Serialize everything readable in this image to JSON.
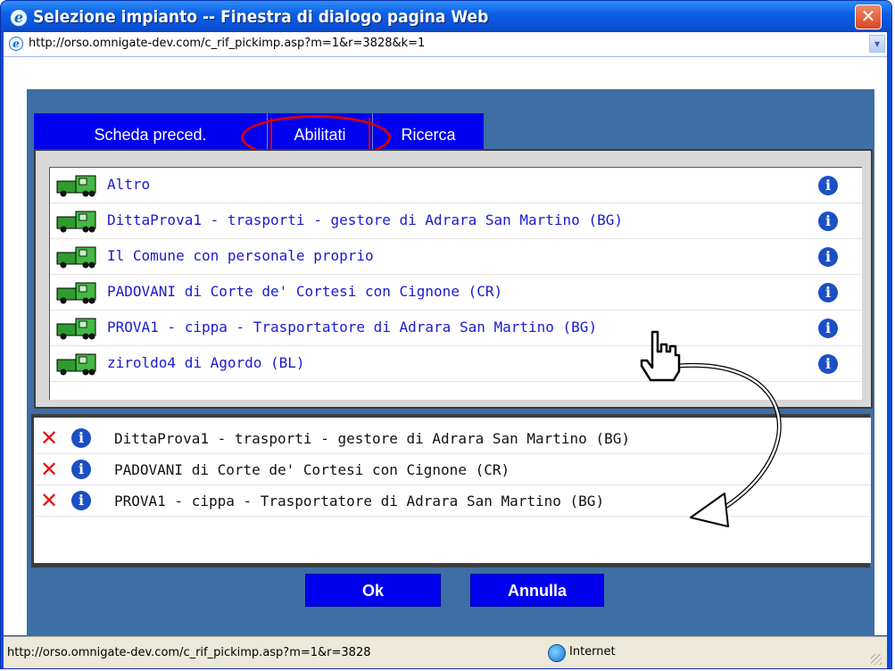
{
  "window": {
    "title": "Selezione impianto -- Finestra di dialogo pagina Web",
    "close_icon": "close-icon"
  },
  "address": {
    "url": "http://orso.omnigate-dev.com/c_rif_pickimp.asp?m=1&r=3828&k=1"
  },
  "tabs": [
    {
      "label": "Scheda preced."
    },
    {
      "label": "Abilitati"
    },
    {
      "label": "Ricerca"
    }
  ],
  "available_items": [
    {
      "label": "Altro"
    },
    {
      "label": "DittaProva1 - trasporti - gestore di Adrara San Martino (BG)"
    },
    {
      "label": "Il Comune con personale proprio"
    },
    {
      "label": "PADOVANI di Corte de' Cortesi con Cignone (CR)"
    },
    {
      "label": "PROVA1 - cippa - Trasportatore di Adrara San Martino (BG)"
    },
    {
      "label": "ziroldo4 di Agordo (BL)"
    }
  ],
  "selected_items": [
    {
      "label": "DittaProva1 - trasporti - gestore di Adrara San Martino (BG)"
    },
    {
      "label": "PADOVANI di Corte de' Cortesi con Cignone (CR)"
    },
    {
      "label": "PROVA1 - cippa - Trasportatore di Adrara San Martino (BG)"
    }
  ],
  "buttons": {
    "ok": "Ok",
    "cancel": "Annulla"
  },
  "status": {
    "url": "http://orso.omnigate-dev.com/c_rif_pickimp.asp?m=1&r=3828",
    "zone": "Internet"
  },
  "colors": {
    "tab_blue": "#0000ee",
    "link_blue": "#1a1ad0",
    "annotation_red": "#d90000",
    "delete_red": "#e21414"
  }
}
